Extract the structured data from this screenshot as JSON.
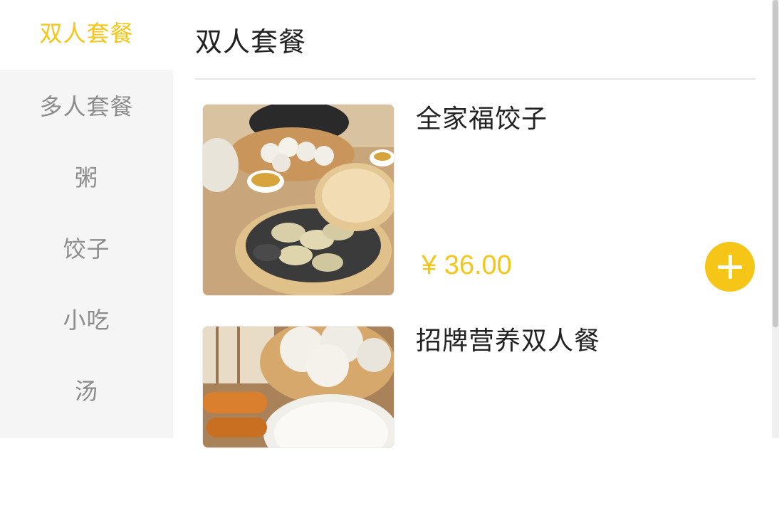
{
  "sidebar": {
    "items": [
      {
        "label": "双人套餐"
      },
      {
        "label": "多人套餐"
      },
      {
        "label": "粥"
      },
      {
        "label": "饺子"
      },
      {
        "label": "小吃"
      },
      {
        "label": "汤"
      }
    ]
  },
  "main": {
    "section_title": "双人套餐",
    "products": [
      {
        "name": "全家福饺子",
        "price": "¥ 36.00"
      },
      {
        "name": "招牌营养双人餐"
      }
    ]
  },
  "colors": {
    "accent": "#f5c518",
    "sidebar_bg": "#f5f5f5"
  },
  "icons": {
    "add": "plus-icon"
  }
}
